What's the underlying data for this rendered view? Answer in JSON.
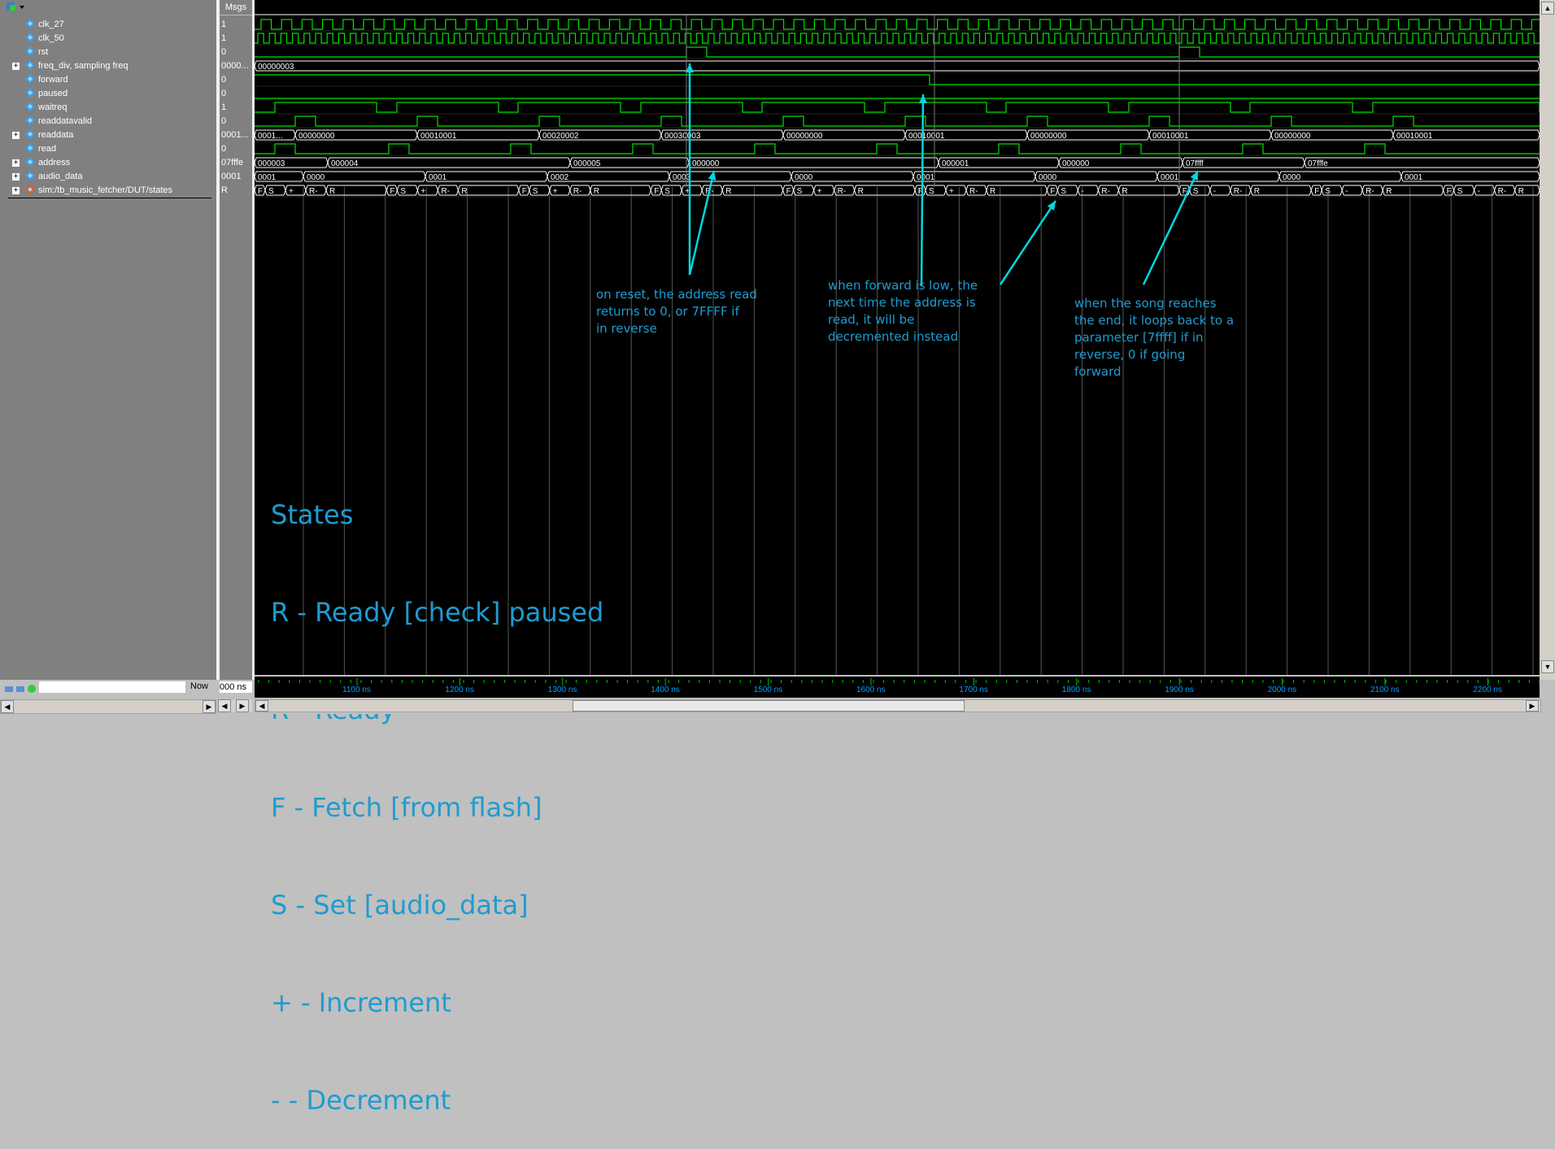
{
  "toolbar": {
    "msgs_header": "Msgs"
  },
  "signals": [
    {
      "name": "clk_27",
      "value": "1",
      "expandable": false,
      "icon": "signal-icon"
    },
    {
      "name": "clk_50",
      "value": "1",
      "expandable": false,
      "icon": "signal-icon"
    },
    {
      "name": "rst",
      "value": "0",
      "expandable": false,
      "icon": "signal-icon"
    },
    {
      "name": "freq_div, sampling freq",
      "value": "0000...",
      "expandable": true,
      "icon": "bus-icon"
    },
    {
      "name": "forward",
      "value": "0",
      "expandable": false,
      "icon": "signal-icon"
    },
    {
      "name": "paused",
      "value": "0",
      "expandable": false,
      "icon": "signal-icon"
    },
    {
      "name": "waitreq",
      "value": "1",
      "expandable": false,
      "icon": "signal-icon"
    },
    {
      "name": "readdatavalid",
      "value": "0",
      "expandable": false,
      "icon": "signal-icon"
    },
    {
      "name": "readdata",
      "value": "0001...",
      "expandable": true,
      "icon": "bus-icon"
    },
    {
      "name": "read",
      "value": "0",
      "expandable": false,
      "icon": "signal-icon"
    },
    {
      "name": "address",
      "value": "07fffe",
      "expandable": true,
      "icon": "bus-icon"
    },
    {
      "name": "audio_data",
      "value": "0001",
      "expandable": true,
      "icon": "bus-icon"
    },
    {
      "name": "sim:/tb_music_fetcher/DUT/states",
      "value": "R",
      "expandable": true,
      "icon": "state-icon"
    }
  ],
  "buses": {
    "freq_div": [
      "00000003"
    ],
    "readdata": [
      "0001...",
      "00000000",
      "00010001",
      "00020002",
      "00030003",
      "00000000",
      "00010001",
      "00000000",
      "00010001",
      "00000000",
      "00010001"
    ],
    "address": [
      "000003",
      "000004",
      "000005",
      "000000",
      "000001",
      "000000",
      "07ffff",
      "07fffe"
    ],
    "audio_data": [
      "0001",
      "0000",
      "0001",
      "0002",
      "0003",
      "0000",
      "0001",
      "0000",
      "0001",
      "0000",
      "0001"
    ],
    "states": [
      "F",
      "S",
      "+",
      "R-",
      "R",
      "F",
      "S",
      "+",
      "R-",
      "R",
      "F",
      "S",
      "+",
      "R-",
      "R",
      "F",
      "S",
      "+",
      "R-",
      "R",
      "F",
      "S",
      "+",
      "R-",
      "R",
      "F",
      "S",
      "+",
      "R-",
      "R",
      "F",
      "S",
      "-",
      "R-",
      "R",
      "F",
      "S",
      "-",
      "R-",
      "R",
      "F",
      "S",
      "-",
      "R-",
      "R",
      "F",
      "S",
      "-",
      "R-",
      "R"
    ]
  },
  "annotations": {
    "reset": "on reset, the address read\nreturns to 0, or 7FFFF if\nin reverse",
    "forward": "when forward is low, the\nnext time the address is\nread, it will be\ndecremented instead",
    "loop": "when the song reaches\nthe end, it loops back to a\nparameter [7ffff] if in\nreverse, 0 if going\nforward"
  },
  "legend": {
    "title": "States",
    "items": [
      "R - Ready [check] paused",
      "R - Ready",
      "F - Fetch [from flash]",
      "S - Set [audio_data]",
      "+ - Increment",
      "- - Decrement"
    ]
  },
  "cursor": {
    "now_label": "Now",
    "now_value": "000 ns"
  },
  "time_axis": [
    "1100 ns",
    "1200 ns",
    "1300 ns",
    "1400 ns",
    "1500 ns",
    "1600 ns",
    "1700 ns",
    "1800 ns",
    "1900 ns",
    "2000 ns",
    "2100 ns",
    "2200 ns"
  ],
  "colors": {
    "wave": "#00e000",
    "annotation": "#1e9cd0",
    "arrow": "#00d8e0",
    "axis_label": "#00a0ff"
  }
}
